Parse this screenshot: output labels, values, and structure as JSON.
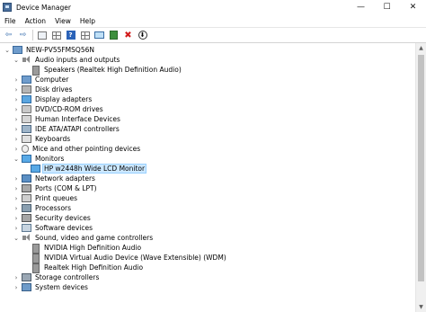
{
  "window": {
    "title": "Device Manager",
    "controls": {
      "minimize": "—",
      "maximize": "☐",
      "close": "✕"
    }
  },
  "menu": [
    "File",
    "Action",
    "View",
    "Help"
  ],
  "toolbar": {
    "icons": [
      "back-arrow-icon",
      "forward-arrow-icon",
      "show-hide-console-tree-icon",
      "properties-icon",
      "help-icon",
      "grid-view-icon",
      "scan-hardware-icon",
      "update-driver-icon",
      "uninstall-icon",
      "disable-device-icon"
    ],
    "back": "⇦",
    "forward": "⇨",
    "help": "?",
    "uninstall": "✖",
    "disable": "⬇"
  },
  "tree": {
    "root": "NEW-PV55FMSQ56N",
    "items": [
      {
        "label": "Audio inputs and outputs",
        "expanded": true,
        "children": [
          "Speakers (Realtek High Definition Audio)"
        ]
      },
      {
        "label": "Computer"
      },
      {
        "label": "Disk drives"
      },
      {
        "label": "Display adapters"
      },
      {
        "label": "DVD/CD-ROM drives"
      },
      {
        "label": "Human Interface Devices"
      },
      {
        "label": "IDE ATA/ATAPI controllers"
      },
      {
        "label": "Keyboards"
      },
      {
        "label": "Mice and other pointing devices"
      },
      {
        "label": "Monitors",
        "expanded": true,
        "children": [
          "HP w2448h Wide LCD Monitor"
        ]
      },
      {
        "label": "Network adapters"
      },
      {
        "label": "Ports (COM & LPT)"
      },
      {
        "label": "Print queues"
      },
      {
        "label": "Processors"
      },
      {
        "label": "Security devices"
      },
      {
        "label": "Software devices"
      },
      {
        "label": "Sound, video and game controllers",
        "expanded": true,
        "children": [
          "NVIDIA High Definition Audio",
          "NVIDIA Virtual Audio Device (Wave Extensible) (WDM)",
          "Realtek High Definition Audio"
        ]
      },
      {
        "label": "Storage controllers"
      },
      {
        "label": "System devices"
      }
    ],
    "selected": "HP w2448h Wide LCD Monitor"
  },
  "glyphs": {
    "expanded": "⌄",
    "collapsed": "›",
    "scroll_up": "▲",
    "scroll_down": "▼"
  },
  "colors": {
    "selection_bg": "#cce8ff",
    "selection_border": "#99d1ff"
  }
}
